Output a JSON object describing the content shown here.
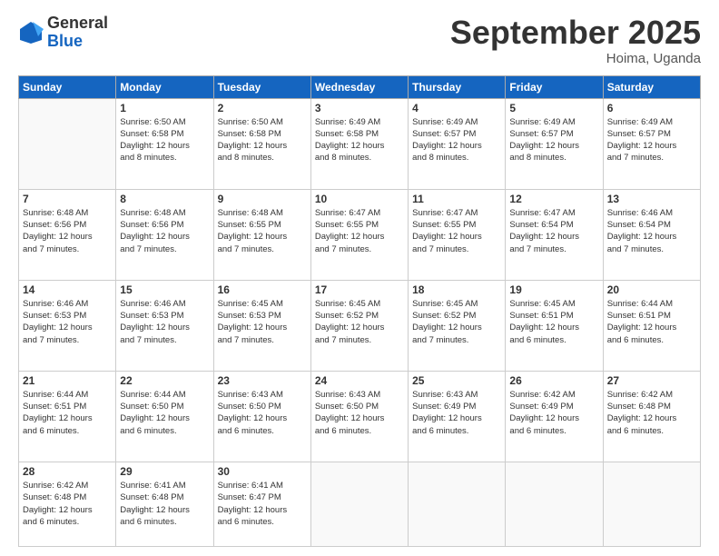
{
  "logo": {
    "general": "General",
    "blue": "Blue"
  },
  "header": {
    "month": "September 2025",
    "location": "Hoima, Uganda"
  },
  "weekdays": [
    "Sunday",
    "Monday",
    "Tuesday",
    "Wednesday",
    "Thursday",
    "Friday",
    "Saturday"
  ],
  "weeks": [
    [
      {
        "day": "",
        "info": ""
      },
      {
        "day": "1",
        "info": "Sunrise: 6:50 AM\nSunset: 6:58 PM\nDaylight: 12 hours\nand 8 minutes."
      },
      {
        "day": "2",
        "info": "Sunrise: 6:50 AM\nSunset: 6:58 PM\nDaylight: 12 hours\nand 8 minutes."
      },
      {
        "day": "3",
        "info": "Sunrise: 6:49 AM\nSunset: 6:58 PM\nDaylight: 12 hours\nand 8 minutes."
      },
      {
        "day": "4",
        "info": "Sunrise: 6:49 AM\nSunset: 6:57 PM\nDaylight: 12 hours\nand 8 minutes."
      },
      {
        "day": "5",
        "info": "Sunrise: 6:49 AM\nSunset: 6:57 PM\nDaylight: 12 hours\nand 8 minutes."
      },
      {
        "day": "6",
        "info": "Sunrise: 6:49 AM\nSunset: 6:57 PM\nDaylight: 12 hours\nand 7 minutes."
      }
    ],
    [
      {
        "day": "7",
        "info": "Sunrise: 6:48 AM\nSunset: 6:56 PM\nDaylight: 12 hours\nand 7 minutes."
      },
      {
        "day": "8",
        "info": "Sunrise: 6:48 AM\nSunset: 6:56 PM\nDaylight: 12 hours\nand 7 minutes."
      },
      {
        "day": "9",
        "info": "Sunrise: 6:48 AM\nSunset: 6:55 PM\nDaylight: 12 hours\nand 7 minutes."
      },
      {
        "day": "10",
        "info": "Sunrise: 6:47 AM\nSunset: 6:55 PM\nDaylight: 12 hours\nand 7 minutes."
      },
      {
        "day": "11",
        "info": "Sunrise: 6:47 AM\nSunset: 6:55 PM\nDaylight: 12 hours\nand 7 minutes."
      },
      {
        "day": "12",
        "info": "Sunrise: 6:47 AM\nSunset: 6:54 PM\nDaylight: 12 hours\nand 7 minutes."
      },
      {
        "day": "13",
        "info": "Sunrise: 6:46 AM\nSunset: 6:54 PM\nDaylight: 12 hours\nand 7 minutes."
      }
    ],
    [
      {
        "day": "14",
        "info": "Sunrise: 6:46 AM\nSunset: 6:53 PM\nDaylight: 12 hours\nand 7 minutes."
      },
      {
        "day": "15",
        "info": "Sunrise: 6:46 AM\nSunset: 6:53 PM\nDaylight: 12 hours\nand 7 minutes."
      },
      {
        "day": "16",
        "info": "Sunrise: 6:45 AM\nSunset: 6:53 PM\nDaylight: 12 hours\nand 7 minutes."
      },
      {
        "day": "17",
        "info": "Sunrise: 6:45 AM\nSunset: 6:52 PM\nDaylight: 12 hours\nand 7 minutes."
      },
      {
        "day": "18",
        "info": "Sunrise: 6:45 AM\nSunset: 6:52 PM\nDaylight: 12 hours\nand 7 minutes."
      },
      {
        "day": "19",
        "info": "Sunrise: 6:45 AM\nSunset: 6:51 PM\nDaylight: 12 hours\nand 6 minutes."
      },
      {
        "day": "20",
        "info": "Sunrise: 6:44 AM\nSunset: 6:51 PM\nDaylight: 12 hours\nand 6 minutes."
      }
    ],
    [
      {
        "day": "21",
        "info": "Sunrise: 6:44 AM\nSunset: 6:51 PM\nDaylight: 12 hours\nand 6 minutes."
      },
      {
        "day": "22",
        "info": "Sunrise: 6:44 AM\nSunset: 6:50 PM\nDaylight: 12 hours\nand 6 minutes."
      },
      {
        "day": "23",
        "info": "Sunrise: 6:43 AM\nSunset: 6:50 PM\nDaylight: 12 hours\nand 6 minutes."
      },
      {
        "day": "24",
        "info": "Sunrise: 6:43 AM\nSunset: 6:50 PM\nDaylight: 12 hours\nand 6 minutes."
      },
      {
        "day": "25",
        "info": "Sunrise: 6:43 AM\nSunset: 6:49 PM\nDaylight: 12 hours\nand 6 minutes."
      },
      {
        "day": "26",
        "info": "Sunrise: 6:42 AM\nSunset: 6:49 PM\nDaylight: 12 hours\nand 6 minutes."
      },
      {
        "day": "27",
        "info": "Sunrise: 6:42 AM\nSunset: 6:48 PM\nDaylight: 12 hours\nand 6 minutes."
      }
    ],
    [
      {
        "day": "28",
        "info": "Sunrise: 6:42 AM\nSunset: 6:48 PM\nDaylight: 12 hours\nand 6 minutes."
      },
      {
        "day": "29",
        "info": "Sunrise: 6:41 AM\nSunset: 6:48 PM\nDaylight: 12 hours\nand 6 minutes."
      },
      {
        "day": "30",
        "info": "Sunrise: 6:41 AM\nSunset: 6:47 PM\nDaylight: 12 hours\nand 6 minutes."
      },
      {
        "day": "",
        "info": ""
      },
      {
        "day": "",
        "info": ""
      },
      {
        "day": "",
        "info": ""
      },
      {
        "day": "",
        "info": ""
      }
    ]
  ]
}
